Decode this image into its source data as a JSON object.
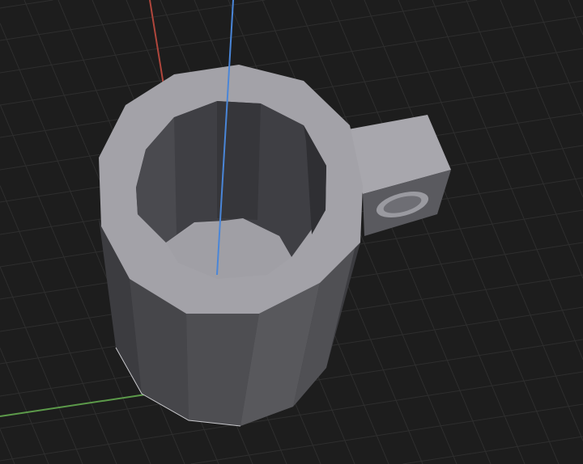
{
  "viewport": {
    "background_color": "#1d1d1d",
    "grid_color": "#2e2e2e",
    "axis_colors": {
      "x": "#b0463c",
      "y": "#5c9a4a",
      "z": "#4a86d8"
    },
    "model_color": "#a3a2a8"
  }
}
